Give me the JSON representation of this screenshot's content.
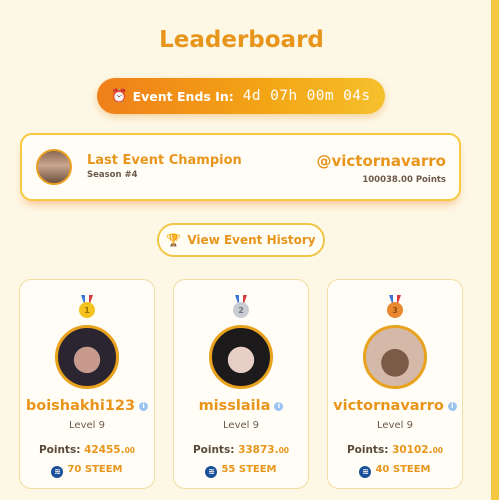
{
  "page": {
    "title": "Leaderboard"
  },
  "event": {
    "alarm_icon": "alarm-clock-icon",
    "ends_label": "Event Ends In:",
    "countdown": "4d 07h 00m 04s"
  },
  "champion": {
    "title": "Last Event Champion",
    "season": "Season #4",
    "username": "@victornavarro",
    "points": "100038.00 Points"
  },
  "history": {
    "label": "View Event History",
    "icon": "trophy-icon"
  },
  "colors": {
    "accent": "#e8951c",
    "gold_border": "#f6c940",
    "background": "#fdf8e6"
  },
  "leaders": [
    {
      "rank": "1",
      "medal": "gold-medal",
      "username": "boishakhi123",
      "level": "Level 9",
      "points_label": "Points:",
      "points_main": "42455.",
      "points_decimal": "00",
      "steem": "70 STEEM"
    },
    {
      "rank": "2",
      "medal": "silver-medal",
      "username": "misslaila",
      "level": "Level 9",
      "points_label": "Points:",
      "points_main": "33873.",
      "points_decimal": "00",
      "steem": "55 STEEM"
    },
    {
      "rank": "3",
      "medal": "bronze-medal",
      "username": "victornavarro",
      "level": "Level 9",
      "points_label": "Points:",
      "points_main": "30102.",
      "points_decimal": "00",
      "steem": "40 STEEM"
    }
  ]
}
